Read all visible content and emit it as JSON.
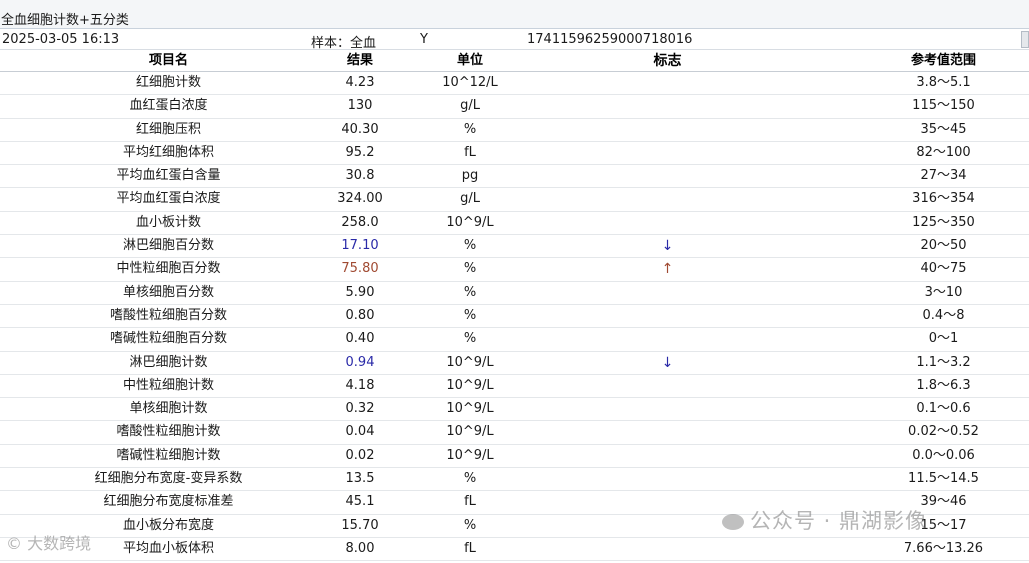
{
  "window": {
    "title": "全血细胞计数+五分类"
  },
  "info": {
    "datetime": "2025-03-05 16:13",
    "sample": "样本：全血",
    "flag": "Y",
    "barcode": "17411596259000718016"
  },
  "columns": {
    "name": "项目名",
    "result": "结果",
    "unit": "单位",
    "flag": "标志",
    "range": "参考值范围"
  },
  "rows": [
    {
      "name": "红细胞计数",
      "result": "4.23",
      "unit": "10^12/L",
      "flag": "",
      "range": "3.8～5.1"
    },
    {
      "name": "血红蛋白浓度",
      "result": "130",
      "unit": "g/L",
      "flag": "",
      "range": "115～150"
    },
    {
      "name": "红细胞压积",
      "result": "40.30",
      "unit": "%",
      "flag": "",
      "range": "35～45"
    },
    {
      "name": "平均红细胞体积",
      "result": "95.2",
      "unit": "fL",
      "flag": "",
      "range": "82～100"
    },
    {
      "name": "平均血红蛋白含量",
      "result": "30.8",
      "unit": "pg",
      "flag": "",
      "range": "27～34"
    },
    {
      "name": "平均血红蛋白浓度",
      "result": "324.00",
      "unit": "g/L",
      "flag": "",
      "range": "316～354"
    },
    {
      "name": "血小板计数",
      "result": "258.0",
      "unit": "10^9/L",
      "flag": "",
      "range": "125～350"
    },
    {
      "name": "淋巴细胞百分数",
      "result": "17.10",
      "unit": "%",
      "flag": "↓",
      "range": "20～50"
    },
    {
      "name": "中性粒细胞百分数",
      "result": "75.80",
      "unit": "%",
      "flag": "↑",
      "range": "40～75"
    },
    {
      "name": "单核细胞百分数",
      "result": "5.90",
      "unit": "%",
      "flag": "",
      "range": "3～10"
    },
    {
      "name": "嗜酸性粒细胞百分数",
      "result": "0.80",
      "unit": "%",
      "flag": "",
      "range": "0.4～8"
    },
    {
      "name": "嗜碱性粒细胞百分数",
      "result": "0.40",
      "unit": "%",
      "flag": "",
      "range": "0～1"
    },
    {
      "name": "淋巴细胞计数",
      "result": "0.94",
      "unit": "10^9/L",
      "flag": "↓",
      "range": "1.1～3.2"
    },
    {
      "name": "中性粒细胞计数",
      "result": "4.18",
      "unit": "10^9/L",
      "flag": "",
      "range": "1.8～6.3"
    },
    {
      "name": "单核细胞计数",
      "result": "0.32",
      "unit": "10^9/L",
      "flag": "",
      "range": "0.1～0.6"
    },
    {
      "name": "嗜酸性粒细胞计数",
      "result": "0.04",
      "unit": "10^9/L",
      "flag": "",
      "range": "0.02～0.52"
    },
    {
      "name": "嗜碱性粒细胞计数",
      "result": "0.02",
      "unit": "10^9/L",
      "flag": "",
      "range": "0.0～0.06"
    },
    {
      "name": "红细胞分布宽度-变异系数",
      "result": "13.5",
      "unit": "%",
      "flag": "",
      "range": "11.5～14.5"
    },
    {
      "name": "红细胞分布宽度标准差",
      "result": "45.1",
      "unit": "fL",
      "flag": "",
      "range": "39～46"
    },
    {
      "name": "血小板分布宽度",
      "result": "15.70",
      "unit": "%",
      "flag": "",
      "range": "15～17"
    },
    {
      "name": "平均血小板体积",
      "result": "8.00",
      "unit": "fL",
      "flag": "",
      "range": "7.66～13.26"
    }
  ],
  "colors": {
    "low": "#2a2aa8",
    "high": "#a04a32"
  },
  "watermarks": {
    "left": "大数跨境",
    "right": "公众号 · 鼎湖影像"
  }
}
